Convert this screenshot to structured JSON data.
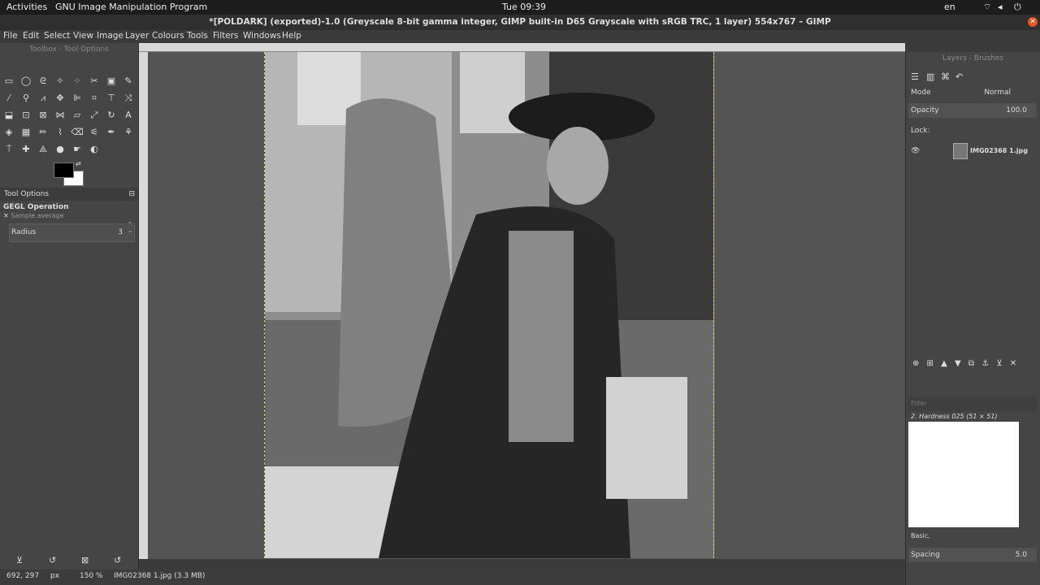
{
  "topbar": {
    "activities": "Activities",
    "app": "GNU Image Manipulation Program",
    "clock": "Tue 09:39",
    "lang": "en"
  },
  "title": "*[POLDARK] (exported)-1.0 (Greyscale 8-bit gamma integer, GIMP built-in D65 Grayscale with sRGB TRC, 1 layer) 554x767 – GIMP",
  "menu": [
    "File",
    "Edit",
    "Select",
    "View",
    "Image",
    "Layer",
    "Colours",
    "Tools",
    "Filters",
    "Windows",
    "Help"
  ],
  "toolbox": {
    "header": "Toolbox - Tool Options",
    "tool_options_tab": "Tool Options",
    "operation": "GEGL Operation",
    "sample": "Sample average",
    "radius_label": "Radius",
    "radius_value": "3"
  },
  "status": {
    "coords": "692, 297",
    "unit": "px",
    "zoom": "150 %",
    "file": "IMG02368 1.jpg (3.3 MB)"
  },
  "layers": {
    "header": "Layers - Brushes",
    "mode_label": "Mode",
    "mode_value": "Normal",
    "opacity_label": "Opacity",
    "opacity_value": "100.0",
    "lock_label": "Lock:",
    "layer_name": "IMG02368 1.jpg"
  },
  "brushes": {
    "filter_placeholder": "Filter",
    "brush_name": "2. Hardness 025 (51 × 51)",
    "preset": "Basic,",
    "spacing_label": "Spacing",
    "spacing_value": "5.0"
  },
  "icons": [
    "eye-icon",
    "chain-icon",
    "move-icon"
  ],
  "colors": {
    "fg": "#000000",
    "bg": "#ffffff"
  }
}
